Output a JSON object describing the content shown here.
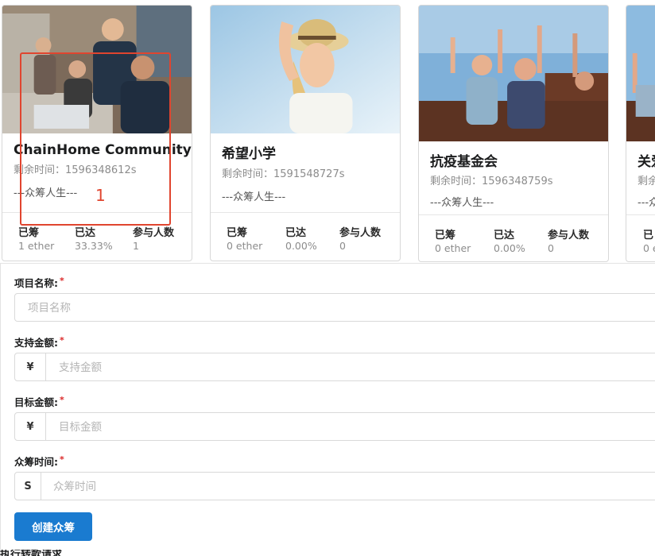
{
  "cards": [
    {
      "title": "ChainHome Community",
      "remaining": "剩余时间：1596348612s",
      "description": "---众筹人生---",
      "stats": [
        {
          "label": "已筹",
          "value": "1 ether"
        },
        {
          "label": "已达",
          "value": "33.33%"
        },
        {
          "label": "参与人数",
          "value": "1"
        }
      ]
    },
    {
      "title": "希望小学",
      "remaining": "剩余时间：1591548727s",
      "description": "---众筹人生---",
      "stats": [
        {
          "label": "已筹",
          "value": "0 ether"
        },
        {
          "label": "已达",
          "value": "0.00%"
        },
        {
          "label": "参与人数",
          "value": "0"
        }
      ]
    },
    {
      "title": "抗疫基金会",
      "remaining": "剩余时间：1596348759s",
      "description": "---众筹人生---",
      "stats": [
        {
          "label": "已筹",
          "value": "0 ether"
        },
        {
          "label": "已达",
          "value": "0.00%"
        },
        {
          "label": "参与人数",
          "value": "0"
        }
      ]
    },
    {
      "title": "关爱",
      "remaining": "剩余",
      "description": "---众",
      "stats": [
        {
          "label": "已",
          "value": "0 e"
        }
      ]
    }
  ],
  "annotation": {
    "number": "1",
    "color": "#e0452f"
  },
  "form": {
    "fields": [
      {
        "label": "项目名称:",
        "placeholder": "项目名称"
      },
      {
        "label": "支持金额:",
        "addon": "¥",
        "placeholder": "支持金额"
      },
      {
        "label": "目标金额:",
        "addon": "¥",
        "placeholder": "目标金额"
      },
      {
        "label": "众筹时间:",
        "addon": "S",
        "placeholder": "众筹时间"
      }
    ],
    "required_mark": "*",
    "submit_label": "创建众筹",
    "next_section_label": "执行转款请求"
  },
  "colors": {
    "primary": "#1a7bd0",
    "required": "#db2828"
  }
}
